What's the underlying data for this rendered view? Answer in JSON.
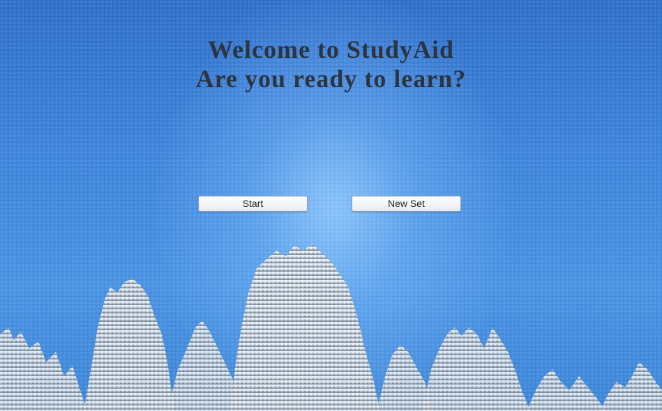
{
  "welcome": {
    "line1": "Welcome to StudyAid",
    "line2": "Are you ready to learn?"
  },
  "buttons": {
    "start": "Start",
    "new_set": "New Set"
  },
  "colors": {
    "sky_top": "#2f6fc9",
    "sky_glow": "#96cdff",
    "title_text": "#2b3440",
    "button_bg": "#f3f5f8"
  }
}
